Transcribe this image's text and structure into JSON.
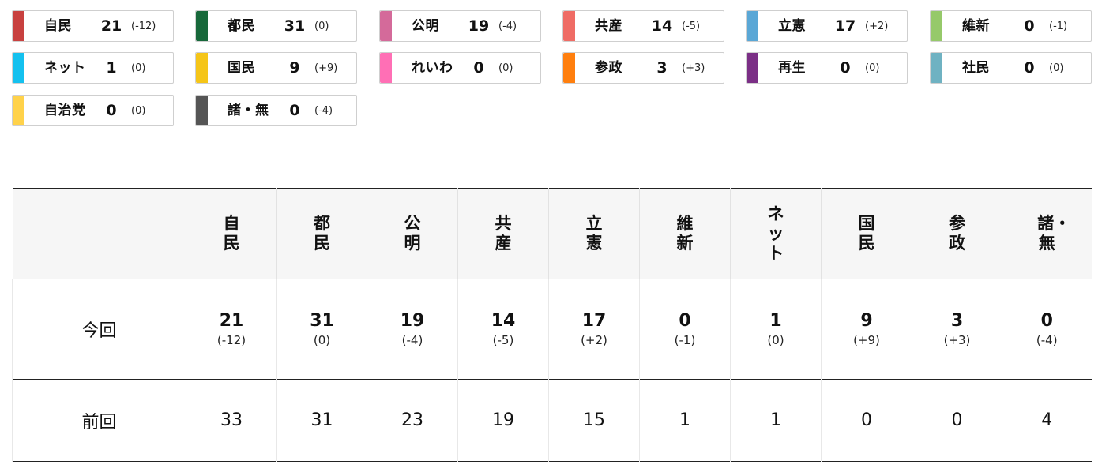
{
  "chips": [
    {
      "name": "自民",
      "seats": "21",
      "change": "(-12)",
      "color": "#c8413f"
    },
    {
      "name": "都民",
      "seats": "31",
      "change": "(0)",
      "color": "#17683a"
    },
    {
      "name": "公明",
      "seats": "19",
      "change": "(-4)",
      "color": "#d46a9a"
    },
    {
      "name": "共産",
      "seats": "14",
      "change": "(-5)",
      "color": "#ef6c65"
    },
    {
      "name": "立憲",
      "seats": "17",
      "change": "(+2)",
      "color": "#5aa7d6"
    },
    {
      "name": "維新",
      "seats": "0",
      "change": "(-1)",
      "color": "#96c96a"
    },
    {
      "name": "ネット",
      "seats": "1",
      "change": "(0)",
      "color": "#14c1ef"
    },
    {
      "name": "国民",
      "seats": "9",
      "change": "(+9)",
      "color": "#f5c518"
    },
    {
      "name": "れいわ",
      "seats": "0",
      "change": "(0)",
      "color": "#ff6fb5"
    },
    {
      "name": "参政",
      "seats": "3",
      "change": "(+3)",
      "color": "#ff7f0e"
    },
    {
      "name": "再生",
      "seats": "0",
      "change": "(0)",
      "color": "#7b2f86"
    },
    {
      "name": "社民",
      "seats": "0",
      "change": "(0)",
      "color": "#6fb2c2"
    },
    {
      "name": "自治党",
      "seats": "0",
      "change": "(0)",
      "color": "#ffd24a"
    },
    {
      "name": "諸・無",
      "seats": "0",
      "change": "(-4)",
      "color": "#555555"
    }
  ],
  "table": {
    "parties": [
      "自民",
      "都民",
      "公明",
      "共産",
      "立憲",
      "維新",
      "ネット",
      "国民",
      "参政",
      "諸・無"
    ],
    "current_label": "今回",
    "current": [
      {
        "seats": "21",
        "change": "(-12)"
      },
      {
        "seats": "31",
        "change": "(0)"
      },
      {
        "seats": "19",
        "change": "(-4)"
      },
      {
        "seats": "14",
        "change": "(-5)"
      },
      {
        "seats": "17",
        "change": "(+2)"
      },
      {
        "seats": "0",
        "change": "(-1)"
      },
      {
        "seats": "1",
        "change": "(0)"
      },
      {
        "seats": "9",
        "change": "(+9)"
      },
      {
        "seats": "3",
        "change": "(+3)"
      },
      {
        "seats": "0",
        "change": "(-4)"
      }
    ],
    "previous_label": "前回",
    "previous": [
      "33",
      "31",
      "23",
      "19",
      "15",
      "1",
      "1",
      "0",
      "0",
      "4"
    ]
  }
}
